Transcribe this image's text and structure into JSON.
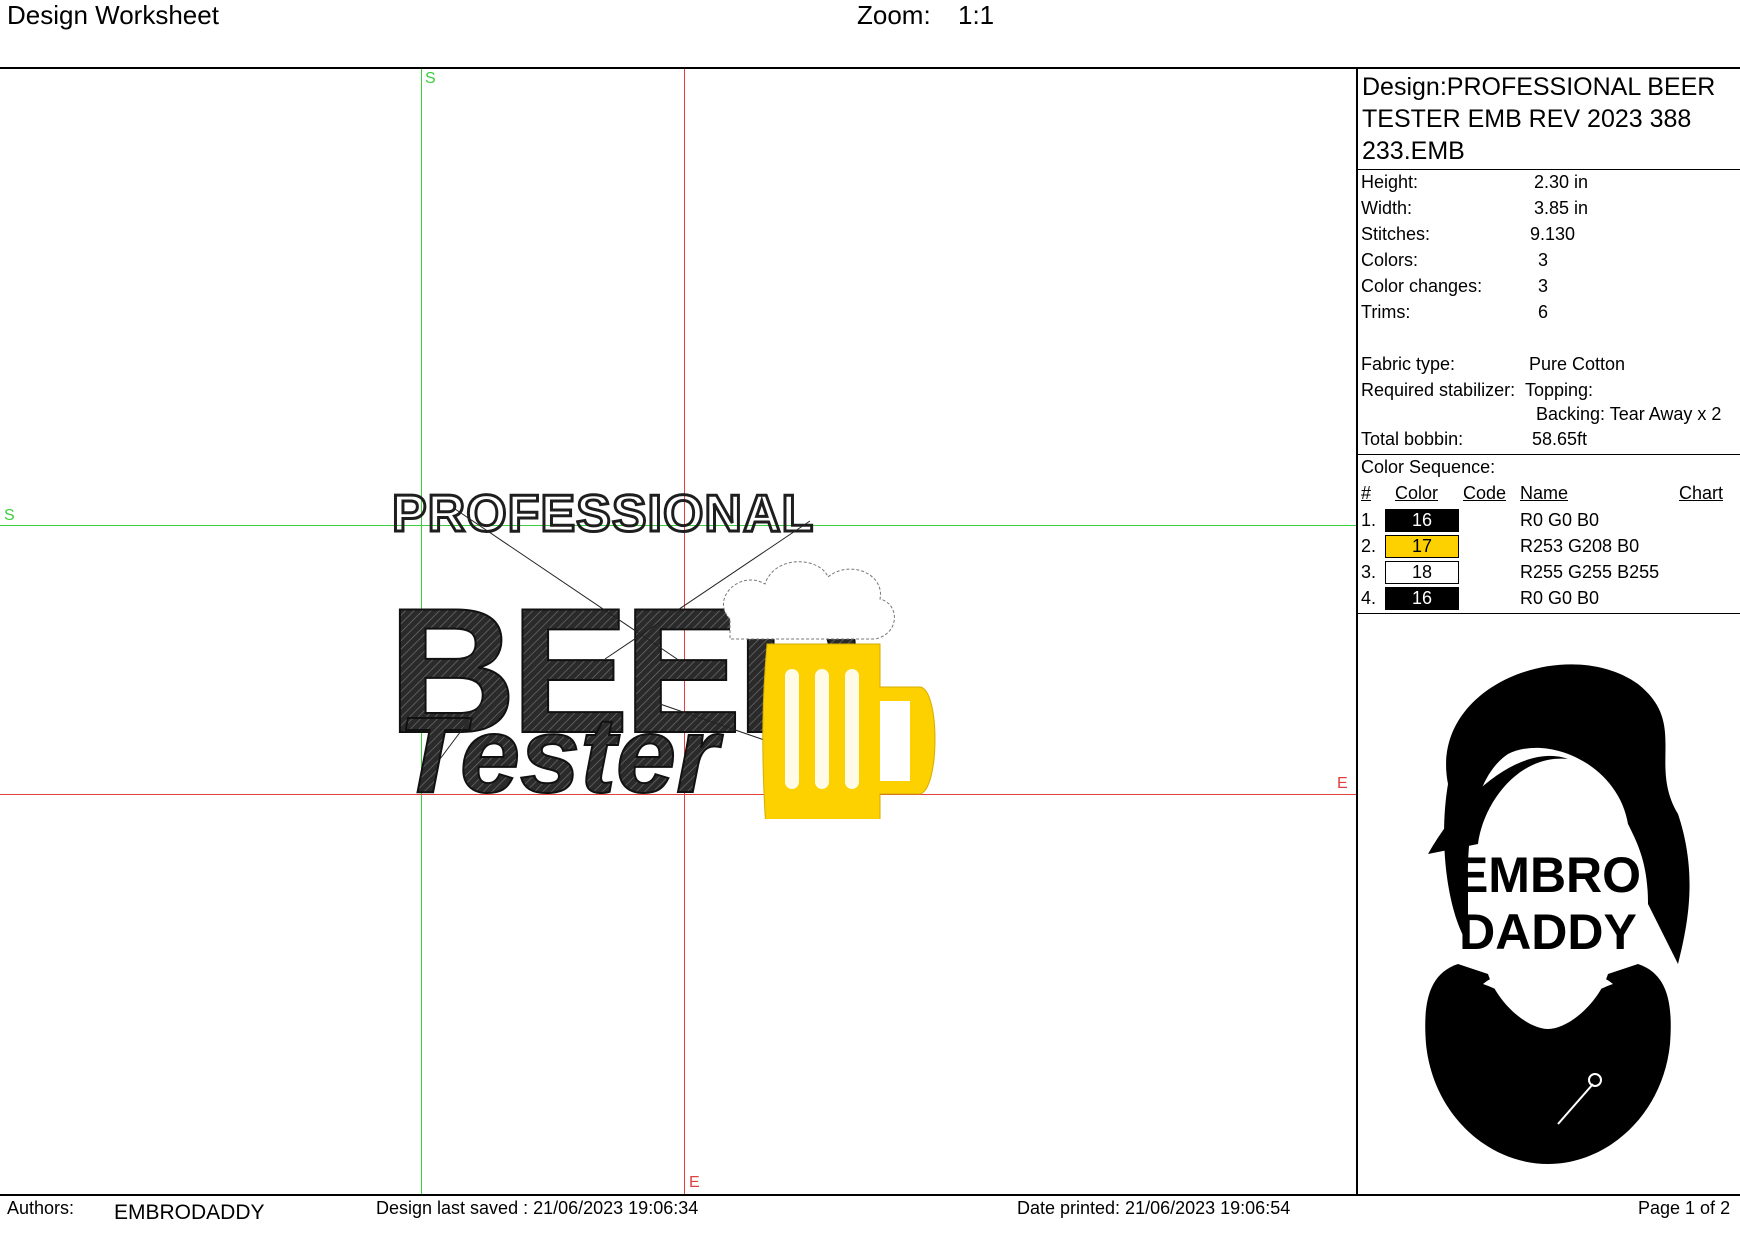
{
  "header": {
    "title": "Design Worksheet",
    "zoom_label": "Zoom:",
    "zoom_value": "1:1"
  },
  "canvas": {
    "marker_start": "S",
    "marker_end": "E",
    "artwork": {
      "line1": "PROFESSIONAL",
      "line2": "BEER",
      "line3": "Tester",
      "colors": {
        "black": "#1e1e1e",
        "gold": "#FDD000",
        "white": "#FFFFFF"
      }
    }
  },
  "panel": {
    "design_title": "Design:PROFESSIONAL BEER TESTER EMB REV 2023 388 233.EMB",
    "specs": [
      {
        "label": "Height:",
        "value": "2.30 in"
      },
      {
        "label": "Width:",
        "value": "3.85 in"
      },
      {
        "label": "Stitches:",
        "value": "9.130"
      },
      {
        "label": "Colors:",
        "value": "3"
      },
      {
        "label": "Color changes:",
        "value": "3"
      },
      {
        "label": "Trims:",
        "value": "6"
      }
    ],
    "fabric_label": "Fabric type:",
    "fabric_value": "Pure Cotton",
    "stabilizer_label": "Required stabilizer:",
    "topping_label": "Topping:",
    "backing_label": "Backing: Tear Away x 2",
    "bobbin_label": "Total bobbin:",
    "bobbin_value": "58.65ft",
    "color_sequence_title": "Color Sequence:",
    "columns": {
      "num": "#",
      "color": "Color",
      "code": "Code",
      "name": "Name",
      "chart": "Chart"
    },
    "colors": [
      {
        "num": "1.",
        "color": "16",
        "name": "R0 G0 B0",
        "hex": "#000000",
        "text_color": "#FFFFFF"
      },
      {
        "num": "2.",
        "color": "17",
        "name": "R253 G208 B0",
        "hex": "#FDD000",
        "text_color": "#000000"
      },
      {
        "num": "3.",
        "color": "18",
        "name": "R255 G255 B255",
        "hex": "#FFFFFF",
        "text_color": "#000000"
      },
      {
        "num": "4.",
        "color": "16",
        "name": "R0 G0 B0",
        "hex": "#000000",
        "text_color": "#FFFFFF"
      }
    ],
    "logo": {
      "line1": "EMBRO",
      "line2": "DADDY"
    }
  },
  "footer": {
    "authors_label": "Authors:",
    "authors_value": "EMBRODADDY",
    "saved": "Design last saved : 21/06/2023 19:06:34",
    "printed": "Date printed: 21/06/2023 19:06:54",
    "page": "Page 1 of 2"
  }
}
